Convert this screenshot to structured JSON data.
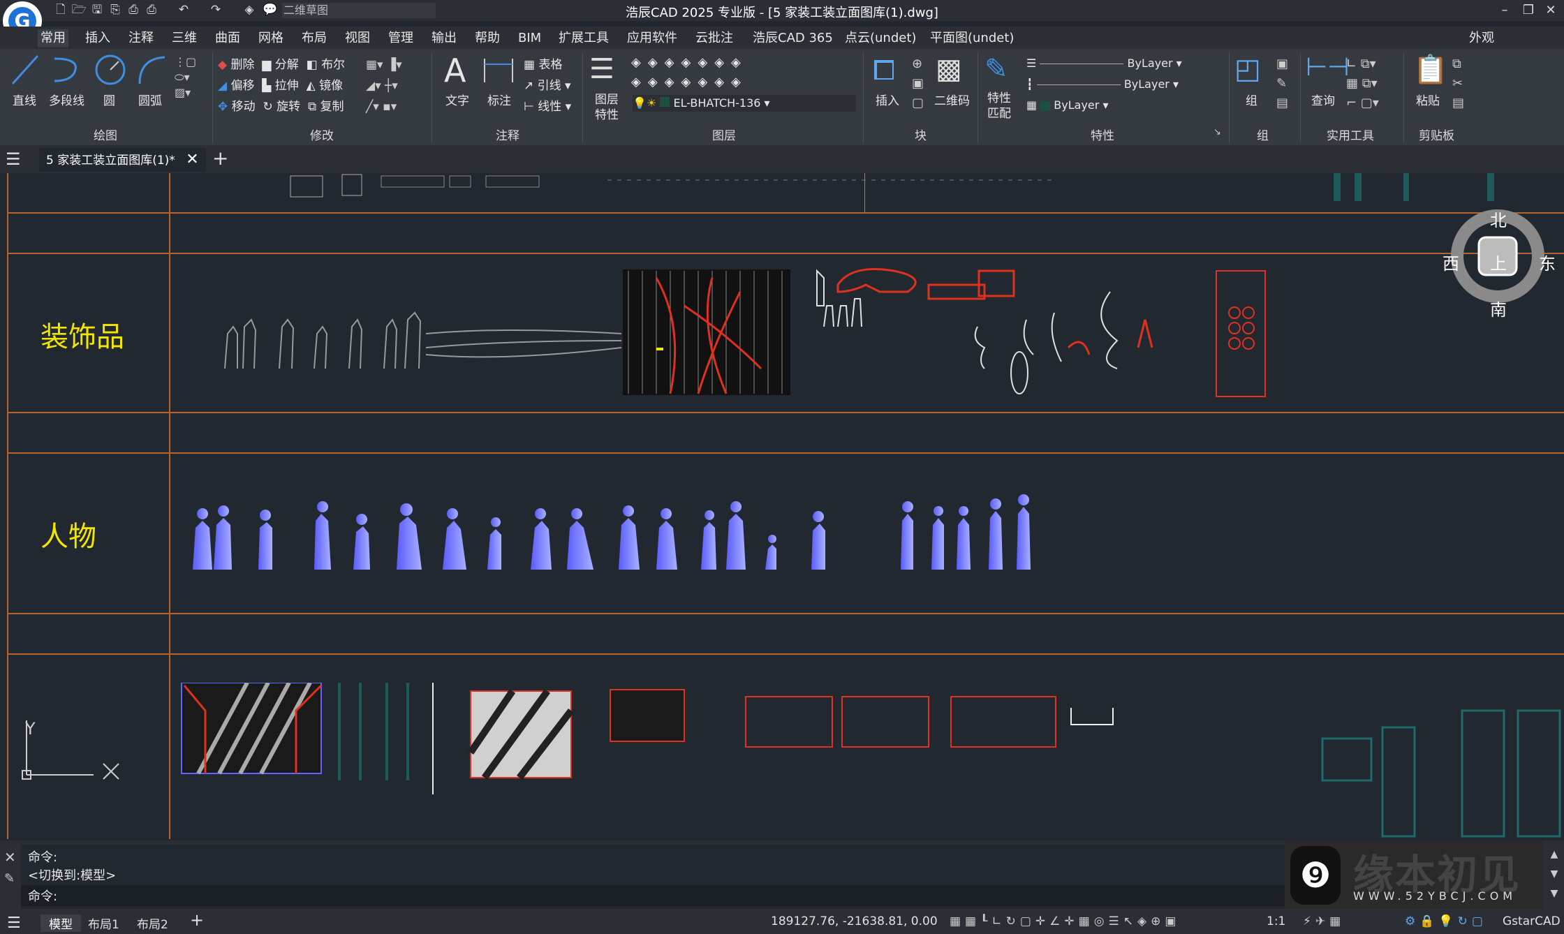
{
  "window": {
    "title": "浩辰CAD 2025 专业版 - [5 家装工装立面图库(1).dwg]",
    "workspace": "二维草图",
    "appearance": "外观"
  },
  "menu": [
    "常用",
    "插入",
    "注释",
    "三维",
    "曲面",
    "网格",
    "布局",
    "视图",
    "管理",
    "输出",
    "帮助",
    "BIM",
    "扩展工具",
    "应用软件",
    "云批注",
    "浩辰CAD 365",
    "点云(undet)",
    "平面图(undet)"
  ],
  "ribbon": {
    "draw": {
      "label": "绘图",
      "line": "直线",
      "polyline": "多段线",
      "circle": "圆",
      "arc": "圆弧"
    },
    "modify": {
      "label": "修改",
      "delete": "删除",
      "explode": "分解",
      "boolean": "布尔",
      "offset": "偏移",
      "stretch": "拉伸",
      "mirror": "镜像",
      "move": "移动",
      "rotate": "旋转",
      "copy": "复制"
    },
    "annotate": {
      "label": "注释",
      "text": "文字",
      "dim": "标注",
      "table": "表格",
      "leader": "引线",
      "linetype": "线性"
    },
    "layers": {
      "label": "图层",
      "props": "图层特性",
      "current": "EL-BHATCH-136"
    },
    "block": {
      "label": "块",
      "insert": "插入",
      "qrcode": "二维码"
    },
    "properties": {
      "label": "特性",
      "match": "特性匹配",
      "color": "ByLayer",
      "linetype": "ByLayer",
      "lineweight": "ByLayer"
    },
    "group": {
      "label": "组",
      "group": "组"
    },
    "utilities": {
      "label": "实用工具",
      "query": "查询"
    },
    "clipboard": {
      "label": "剪贴板",
      "paste": "粘贴"
    }
  },
  "document_tab": "5 家装工装立面图库(1)*",
  "drawing": {
    "rows": [
      "装饰品",
      "人物"
    ],
    "compass": {
      "north": "北",
      "south": "南",
      "east": "东",
      "west": "西",
      "top": "上"
    },
    "ucs": {
      "y": "Y"
    }
  },
  "command": {
    "lines": [
      "命令:",
      "<切换到:模型>",
      "命令:"
    ]
  },
  "status": {
    "tabs": [
      "模型",
      "布局1",
      "布局2"
    ],
    "coords": "189127.76, -21638.81, 0.00",
    "scale": "1:1",
    "brand": "GstarCAD"
  },
  "watermark": {
    "text": "缘本初见",
    "url": "WWW.52YBCJ.COM"
  },
  "colors": {
    "accent": "#1e72d6",
    "grid_line": "#b5652b",
    "label": "#f2e600",
    "people": "#6a6cff"
  }
}
